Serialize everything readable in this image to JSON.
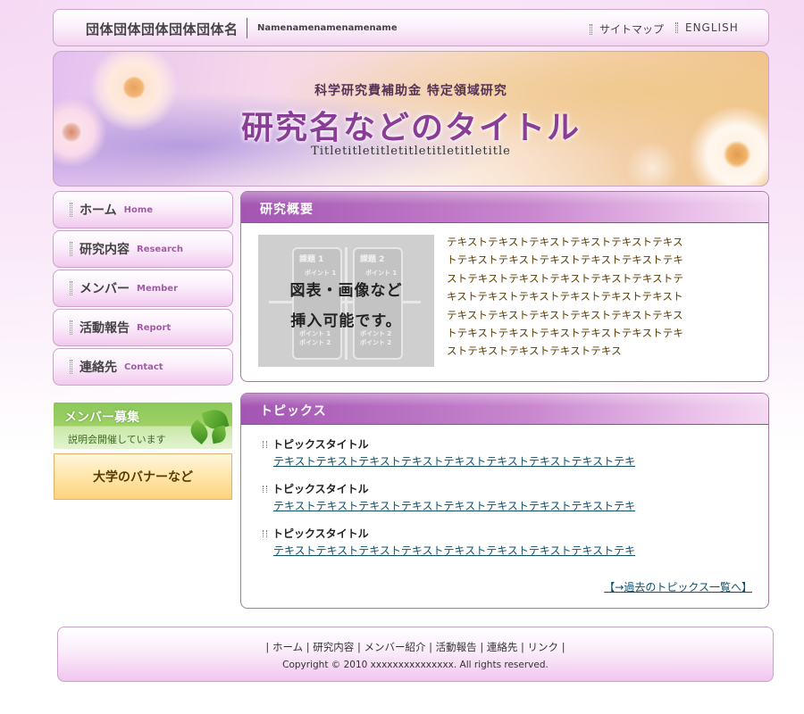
{
  "header": {
    "org_name": "団体団体団体団体団体名",
    "org_name_en": "Namenamenamenamename",
    "links": [
      "サイトマップ",
      "ENGLISH"
    ]
  },
  "banner": {
    "subtitle": "科学研究費補助金 特定領域研究",
    "title": "研究名などのタイトル",
    "title_en": "Titletitletitletitletitletitletitle"
  },
  "nav": [
    {
      "ja": "ホーム",
      "en": "Home"
    },
    {
      "ja": "研究内容",
      "en": "Research"
    },
    {
      "ja": "メンバー",
      "en": "Member"
    },
    {
      "ja": "活動報告",
      "en": "Report"
    },
    {
      "ja": "連絡先",
      "en": "Contact"
    }
  ],
  "side_banners": {
    "member_title": "メンバー募集",
    "member_sub": "説明会開催しています",
    "university": "大学のバナーなど"
  },
  "overview": {
    "heading": "研究概要",
    "image_text_line1": "図表・画像など",
    "image_text_line2": "挿入可能です。",
    "image_labels": [
      "課題 1",
      "課題 2",
      "ポイント 1",
      "ポイント 1",
      "ポイント 1",
      "ポイント 2",
      "ポイント 2",
      "ポイント 2"
    ],
    "body": "テキストテキストテキストテキストテキストテキストテキストテキストテキストテキストテキストテキストテキストテキストテキストテキストテキストテキストテキストテキストテキストテキストテキストテキストテキストテキストテキストテキストテキストテキストテキストテキストテキストテキストテキストテキストテキストテキストテキス"
  },
  "topics": {
    "heading": "トピックス",
    "items": [
      {
        "title": "トピックスタイトル",
        "text": "テキストテキストテキストテキストテキストテキストテキストテキストテキ"
      },
      {
        "title": "トピックスタイトル",
        "text": "テキストテキストテキストテキストテキストテキストテキストテキストテキ"
      },
      {
        "title": "トピックスタイトル",
        "text": "テキストテキストテキストテキストテキストテキストテキストテキストテキ"
      }
    ],
    "past_link": "【→過去のトピックス一覧へ】"
  },
  "footer": {
    "nav": [
      "ホーム",
      "研究内容",
      "メンバー紹介",
      "活動報告",
      "連絡先",
      "リンク"
    ],
    "copyright": "Copyright © 2010 xxxxxxxxxxxxxxx. All rights reserved."
  },
  "colors": {
    "accent": "#a356b2",
    "link": "#0b4f6b",
    "text_brown": "#5a3a00"
  }
}
